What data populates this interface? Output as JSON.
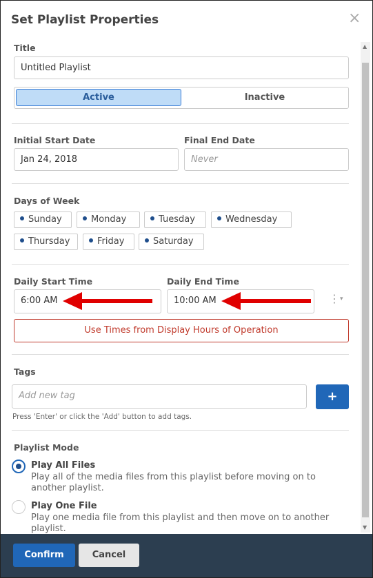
{
  "dialog": {
    "title": "Set Playlist Properties",
    "close_icon": "×"
  },
  "title_field": {
    "label": "Title",
    "value": "Untitled Playlist"
  },
  "status_toggle": {
    "active_label": "Active",
    "inactive_label": "Inactive",
    "selected": "Active"
  },
  "dates": {
    "start_label": "Initial Start Date",
    "start_value": "Jan 24, 2018",
    "end_label": "Final End Date",
    "end_placeholder": "Never"
  },
  "days": {
    "label": "Days of Week",
    "items": [
      "Sunday",
      "Monday",
      "Tuesday",
      "Wednesday",
      "Thursday",
      "Friday",
      "Saturday"
    ]
  },
  "times": {
    "start_label": "Daily Start Time",
    "start_value": "6:00 AM",
    "end_label": "Daily End Time",
    "end_value": "10:00 AM",
    "hours_button": "Use Times from Display Hours of Operation"
  },
  "tags": {
    "label": "Tags",
    "placeholder": "Add new tag",
    "add_button": "+",
    "hint": "Press 'Enter' or click the 'Add' button to add tags."
  },
  "playlist_mode": {
    "label": "Playlist Mode",
    "options": [
      {
        "title": "Play All Files",
        "desc": "Play all of the media files from this playlist before moving on to another playlist.",
        "selected": true
      },
      {
        "title": "Play One File",
        "desc": "Play one media file from this playlist and then move on to another playlist.",
        "selected": false
      }
    ]
  },
  "footer": {
    "confirm": "Confirm",
    "cancel": "Cancel"
  },
  "colors": {
    "accent": "#2067b8",
    "footer_bg": "#2c3e50",
    "annotation_arrow": "#e00000",
    "hours_button": "#c0392b"
  }
}
